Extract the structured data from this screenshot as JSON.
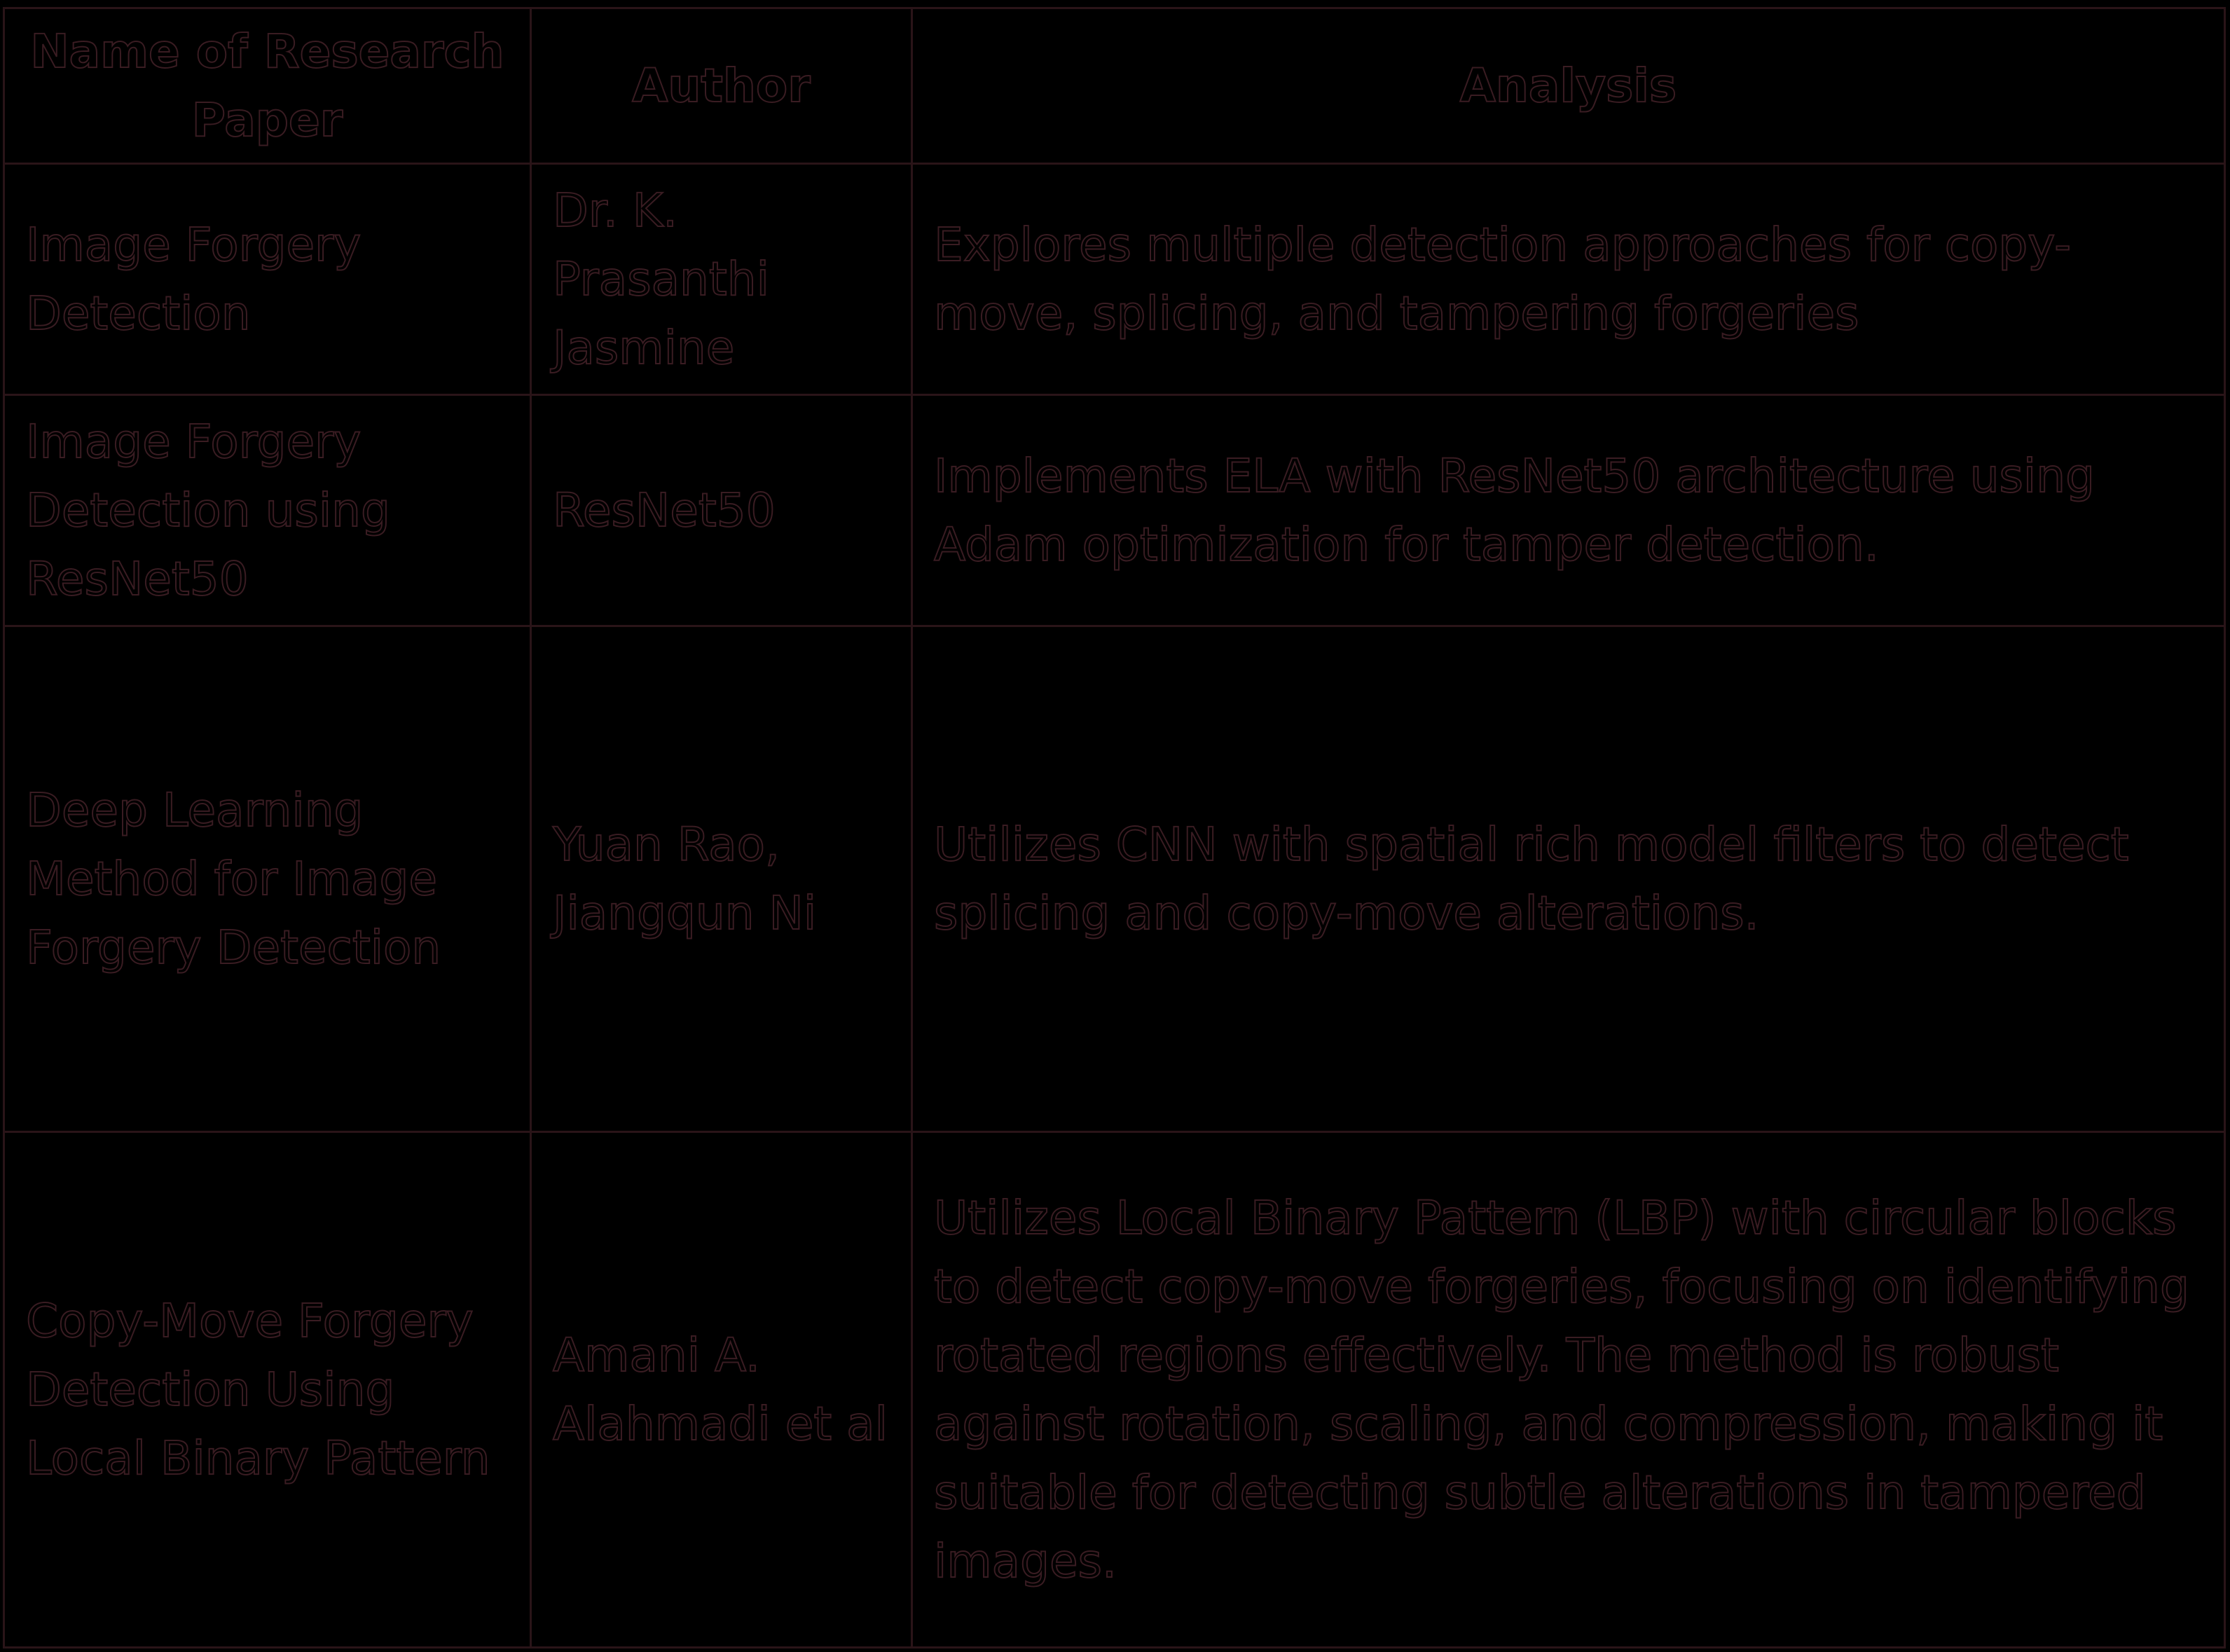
{
  "table": {
    "headers": [
      "Name of Research Paper",
      "Author",
      "Analysis"
    ],
    "rows": [
      {
        "paper": "Image Forgery Detection",
        "author": "Dr. K. Prasanthi Jasmine",
        "analysis": " Explores multiple detection approaches for copy-move, splicing, and tampering forgeries"
      },
      {
        "paper": "Image Forgery Detection using ResNet50",
        "author": "ResNet50",
        "analysis": " Implements ELA with ResNet50 architecture using Adam optimization for tamper detection."
      },
      {
        "paper": "Deep Learning Method for Image Forgery Detection",
        "author": "Yuan Rao, Jiangqun Ni",
        "analysis": "Utilizes CNN with spatial rich model filters to detect splicing and copy-move alterations."
      },
      {
        "paper": "Copy-Move Forgery Detection Using Local Binary Pattern",
        "author": "Amani A. Alahmadi et al",
        "analysis": "Utilizes Local Binary Pattern (LBP) with circular blocks to detect copy-move forgeries, focusing on identifying rotated regions effectively. The method is robust against rotation, scaling, and compression, making it suitable for detecting subtle alterations in tampered images."
      }
    ]
  }
}
